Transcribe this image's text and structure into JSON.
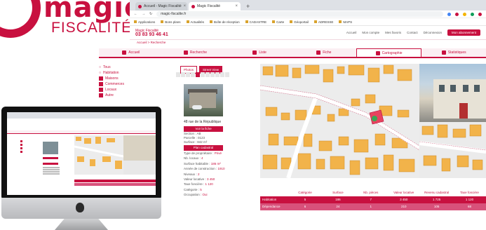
{
  "logo": {
    "word": "magic",
    "sub": "FISCALITÉ"
  },
  "browser": {
    "tabs": [
      {
        "label": "Accueil - Magic Fiscalité"
      },
      {
        "label": "Magic Fiscalité"
      }
    ],
    "url": "magic-fiscalite.fr",
    "bookmarks": [
      "Applications",
      "Bons plans",
      "Actualités",
      "Boîte de réception",
      "CADASTRE",
      "Carte",
      "Géoportail",
      "ADRESSE",
      "MAPS"
    ]
  },
  "app": {
    "brand_name": "Magic Fiscalité",
    "phone": "03 83 93 46 41",
    "top_links": [
      "Accueil",
      "Mon compte",
      "Mes favoris",
      "Contact",
      "Déconnexion"
    ],
    "top_button": "Mon abonnement",
    "breadcrumb": "Accueil > Recherche",
    "nav": [
      "Accueil",
      "Recherche",
      "Liste",
      "Fiche",
      "Cartographie",
      "Statistiques"
    ]
  },
  "filters": [
    "Tous",
    "Habitation",
    "Maisons",
    "Commerces",
    "Locaux",
    "Autre"
  ],
  "middle": {
    "btn_photos": "Photos",
    "btn_streetview": "Street View",
    "address": "48 rue de la République",
    "btn_details": "Voir la fiche",
    "info_lines": [
      "Section : AB",
      "Parcelle : 0123",
      "Surface : 842 m²"
    ],
    "btn_cadastre": "Plan cadastral",
    "info2": [
      {
        "label": "Type de propriétaire :",
        "value": "Privé"
      },
      {
        "label": "Nb. locaux :",
        "value": "4"
      },
      {
        "label": "Surface habitable :",
        "value": "186 m²"
      },
      {
        "label": "Année de construction :",
        "value": "1910"
      },
      {
        "label": "Niveaux :",
        "value": "2"
      },
      {
        "label": "Valeur locative :",
        "value": "3 450"
      },
      {
        "label": "Taxe foncière :",
        "value": "1 120"
      },
      {
        "label": "Catégorie :",
        "value": "5"
      },
      {
        "label": "Occupation :",
        "value": "Oui"
      }
    ]
  },
  "table": {
    "headers": [
      "",
      "Catégorie",
      "Surface",
      "Nb. pièces",
      "Valeur locative",
      "Revenu cadastral",
      "Taxe foncière"
    ],
    "rows": [
      [
        "Habitation",
        "5",
        "186",
        "7",
        "3 450",
        "1 725",
        "1 120"
      ],
      [
        "Dépendance",
        "6",
        "24",
        "1",
        "210",
        "105",
        "68"
      ]
    ]
  },
  "colors": {
    "accent": "#c8103f",
    "accent_light": "#d8517a"
  }
}
